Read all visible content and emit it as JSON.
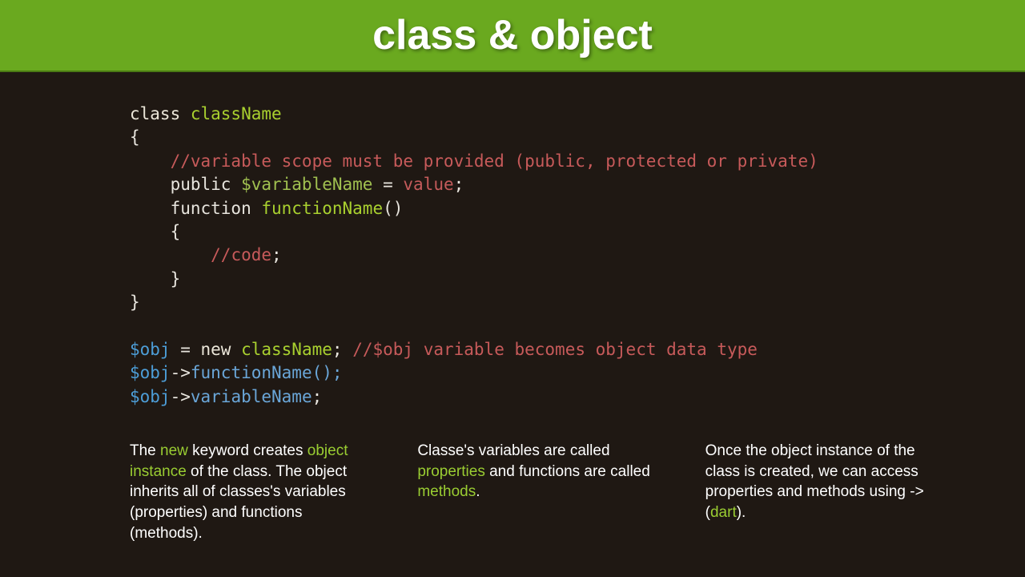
{
  "header": {
    "title": "class & object"
  },
  "code": {
    "l1": {
      "kw": "class ",
      "name": "className"
    },
    "l2": "{",
    "l3": "    //variable scope must be provided (public, protected or private)",
    "l4": {
      "pre": "    public ",
      "var": "$variableName",
      "eq": " = ",
      "val": "value",
      "semi": ";"
    },
    "l5": {
      "pre": "    function ",
      "fn": "functionName",
      "paren": "()"
    },
    "l6": "    {",
    "l7": {
      "indent": "        ",
      "comment": "//code",
      "semi": ";"
    },
    "l8": "    }",
    "l9": "}",
    "l11": {
      "obj": "$obj",
      "eq": " = ",
      "new": "new ",
      "cls": "className",
      "semi": "; ",
      "comment": "//$obj variable becomes object data type"
    },
    "l12": {
      "obj": "$obj",
      "arrow": "->",
      "call": "functionName();"
    },
    "l13": {
      "obj": "$obj",
      "arrow": "->",
      "member": "variableName",
      "semi": ";"
    }
  },
  "cols": {
    "c1": {
      "t1": "The ",
      "new": "new",
      "t2": " keyword creates ",
      "oi": "object instance",
      "t3": " of the class. The object inherits all of classes's variables (properties) and functions (methods)."
    },
    "c2": {
      "t1": "Classe's variables are called ",
      "props": "properties",
      "t2": " and functions are called ",
      "methods": "methods",
      "t3": "."
    },
    "c3": {
      "t1": "Once the object instance of the class is created, we can access properties and methods using -> (",
      "dart": "dart",
      "t2": ")."
    }
  }
}
